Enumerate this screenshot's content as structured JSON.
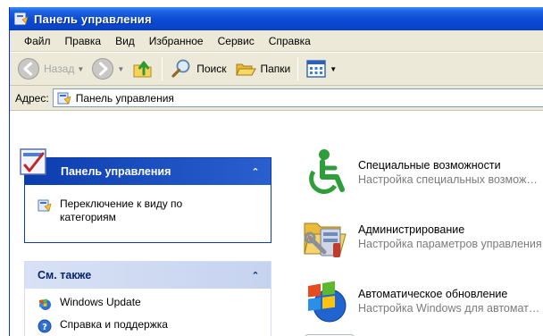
{
  "window": {
    "title": "Панель управления"
  },
  "menu": {
    "items": [
      {
        "label": "Файл"
      },
      {
        "label": "Правка"
      },
      {
        "label": "Вид"
      },
      {
        "label": "Избранное"
      },
      {
        "label": "Сервис"
      },
      {
        "label": "Справка"
      }
    ]
  },
  "toolbar": {
    "back_label": "Назад",
    "search_label": "Поиск",
    "folders_label": "Папки"
  },
  "address": {
    "label": "Адрес:",
    "value": "Панель управления"
  },
  "tasks_panel": {
    "title": "Панель управления",
    "collapse_glyph": "⌃",
    "link_label": "Переключение к виду по категориям"
  },
  "see_also_panel": {
    "title": "См. также",
    "collapse_glyph": "⌃",
    "links": [
      {
        "label": "Windows Update"
      },
      {
        "label": "Справка и поддержка"
      }
    ]
  },
  "items": [
    {
      "icon": "accessibility-icon",
      "title": "Специальные возможности",
      "description": "Настройка специальных возможностей"
    },
    {
      "icon": "administration-icon",
      "title": "Администрирование",
      "description": "Настройка параметров управления"
    },
    {
      "icon": "windows-update-icon",
      "title": "Автоматическое обновление",
      "description": "Настройка Windows для автоматического обновления"
    }
  ],
  "colors": {
    "titlebar": "#0b4ad3",
    "chrome": "#ece9d8",
    "task_pane": "#6f8fdd",
    "panel_header_primary": "#0c3daf"
  }
}
